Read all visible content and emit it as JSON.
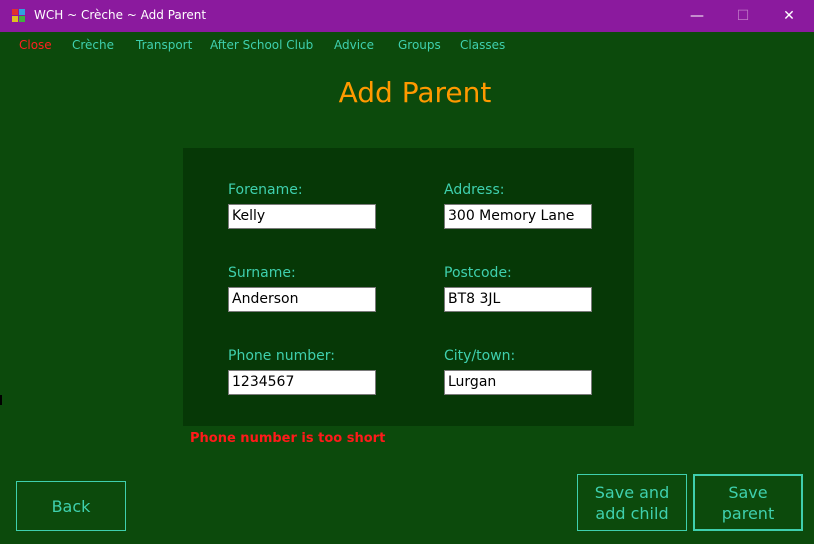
{
  "window": {
    "title": "WCH ~ Crèche ~ Add Parent",
    "controls": {
      "minimize": "—",
      "maximize": "☐",
      "close": "✕"
    }
  },
  "menu": {
    "items": [
      "Close",
      "Crèche",
      "Transport",
      "After School Club",
      "Advice",
      "Groups",
      "Classes"
    ]
  },
  "page": {
    "title": "Add Parent"
  },
  "form": {
    "forename": {
      "label": "Forename:",
      "value": "Kelly"
    },
    "surname": {
      "label": "Surname:",
      "value": "Anderson"
    },
    "phone": {
      "label": "Phone number:",
      "value": "1234567"
    },
    "address": {
      "label": "Address:",
      "value": "300 Memory Lane"
    },
    "postcode": {
      "label": "Postcode:",
      "value": "BT8 3JL"
    },
    "city": {
      "label": "City/town:",
      "value": "Lurgan"
    },
    "error": "Phone number is too short"
  },
  "buttons": {
    "back": "Back",
    "save_and_add_child": "Save and\nadd child",
    "save_parent": "Save\nparent"
  },
  "colors": {
    "titlebar": "#8b1a9e",
    "background": "#0c4a0c",
    "panel": "#063806",
    "accent": "#3fd0ae",
    "heading": "#ff9900",
    "error": "#ff1a1a"
  }
}
